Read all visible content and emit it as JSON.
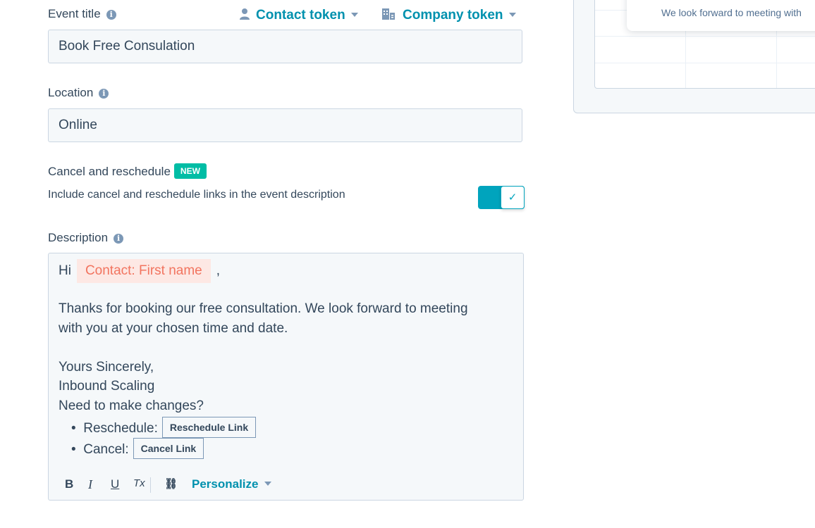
{
  "event_title": {
    "label": "Event title",
    "value": "Book Free Consulation",
    "contact_token_label": "Contact token",
    "company_token_label": "Company token"
  },
  "location": {
    "label": "Location",
    "value": "Online"
  },
  "cancel_reschedule": {
    "label": "Cancel and reschedule",
    "badge": "NEW",
    "description": "Include cancel and reschedule links in the event description",
    "toggle_on": true
  },
  "description": {
    "label": "Description",
    "greeting": "Hi",
    "contact_token": "Contact: First name",
    "comma": ",",
    "body_line1": "Thanks for booking our free consultation. We look forward to meeting",
    "body_line2": "with you at your chosen time and date.",
    "signoff": "Yours Sincerely,",
    "company": "Inbound Scaling",
    "changes_prompt": "Need to make changes?",
    "list": [
      {
        "label": "Reschedule:",
        "link": "Reschedule Link"
      },
      {
        "label": "Cancel:",
        "link": "Cancel Link"
      }
    ],
    "toolbar": {
      "bold": "B",
      "italic": "I",
      "underline": "U",
      "clear_format": "Tx",
      "link": "⛓",
      "personalize": "Personalize"
    }
  },
  "preview": {
    "snippet": "We look forward to meeting with"
  },
  "colors": {
    "accent": "#0091ae",
    "toggle": "#00a4bd",
    "badge": "#00bda5",
    "token_text": "#f2745f",
    "token_bg": "#fde8e4"
  }
}
